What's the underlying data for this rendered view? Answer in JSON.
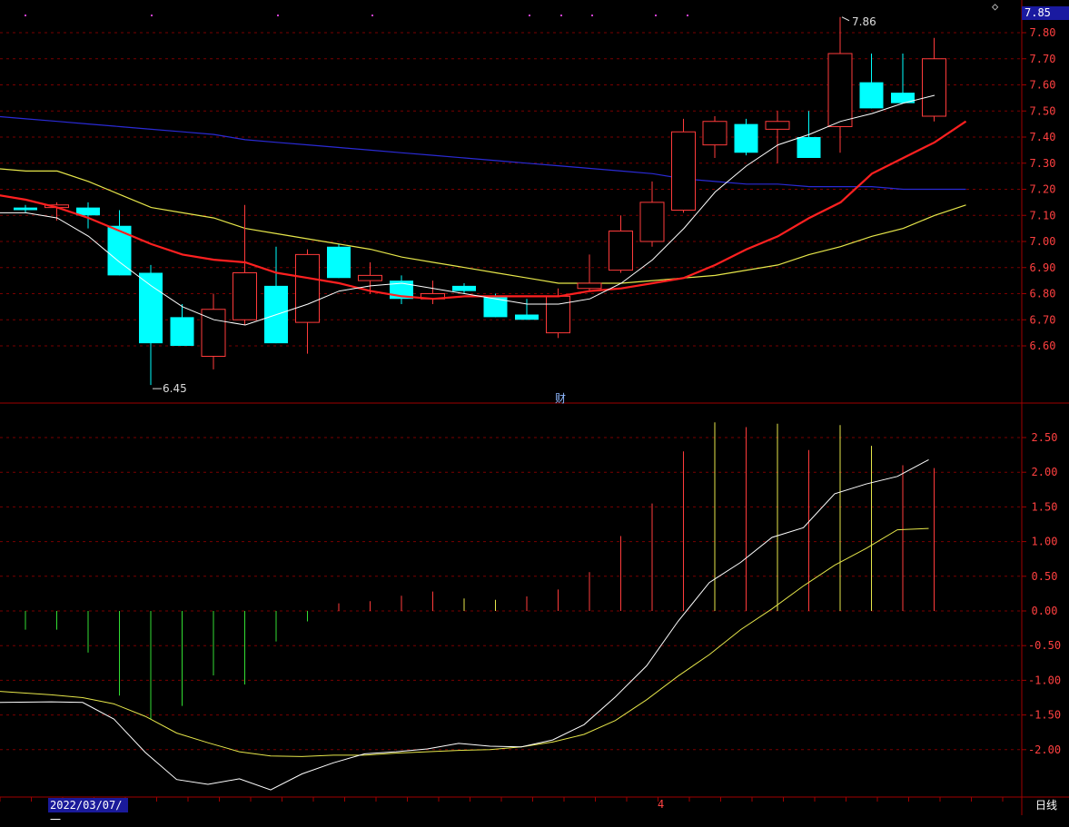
{
  "chart_data": [
    {
      "type": "candlestick",
      "name_id": "price-panel",
      "y_ticks": [
        "7.80",
        "7.70",
        "7.60",
        "7.50",
        "7.40",
        "7.30",
        "7.20",
        "7.10",
        "7.00",
        "6.90",
        "6.80",
        "6.70",
        "6.60"
      ],
      "ylim": [
        6.38,
        7.88
      ],
      "current_price": "7.85",
      "high_annotation": "7.86",
      "low_annotation": "6.45",
      "candles": [
        {
          "o": 7.13,
          "h": 7.14,
          "l": 7.11,
          "c": 7.12
        },
        {
          "o": 7.13,
          "h": 7.15,
          "l": 7.08,
          "c": 7.14
        },
        {
          "o": 7.13,
          "h": 7.15,
          "l": 7.05,
          "c": 7.1
        },
        {
          "o": 7.06,
          "h": 7.12,
          "l": 6.87,
          "c": 6.87
        },
        {
          "o": 6.88,
          "h": 6.91,
          "l": 6.45,
          "c": 6.61
        },
        {
          "o": 6.71,
          "h": 6.76,
          "l": 6.6,
          "c": 6.6
        },
        {
          "o": 6.56,
          "h": 6.8,
          "l": 6.51,
          "c": 6.74
        },
        {
          "o": 6.7,
          "h": 7.14,
          "l": 6.68,
          "c": 6.88
        },
        {
          "o": 6.83,
          "h": 6.98,
          "l": 6.61,
          "c": 6.61
        },
        {
          "o": 6.69,
          "h": 6.97,
          "l": 6.57,
          "c": 6.95
        },
        {
          "o": 6.98,
          "h": 6.99,
          "l": 6.86,
          "c": 6.86
        },
        {
          "o": 6.85,
          "h": 6.92,
          "l": 6.8,
          "c": 6.87
        },
        {
          "o": 6.85,
          "h": 6.87,
          "l": 6.76,
          "c": 6.78
        },
        {
          "o": 6.78,
          "h": 6.85,
          "l": 6.76,
          "c": 6.8
        },
        {
          "o": 6.83,
          "h": 6.84,
          "l": 6.8,
          "c": 6.81
        },
        {
          "o": 6.79,
          "h": 6.8,
          "l": 6.71,
          "c": 6.71
        },
        {
          "o": 6.72,
          "h": 6.78,
          "l": 6.7,
          "c": 6.7
        },
        {
          "o": 6.65,
          "h": 6.82,
          "l": 6.63,
          "c": 6.79
        },
        {
          "o": 6.82,
          "h": 6.95,
          "l": 6.81,
          "c": 6.84
        },
        {
          "o": 6.89,
          "h": 7.1,
          "l": 6.88,
          "c": 7.04
        },
        {
          "o": 7.0,
          "h": 7.23,
          "l": 6.98,
          "c": 7.15
        },
        {
          "o": 7.12,
          "h": 7.47,
          "l": 7.11,
          "c": 7.42
        },
        {
          "o": 7.37,
          "h": 7.48,
          "l": 7.32,
          "c": 7.46
        },
        {
          "o": 7.45,
          "h": 7.47,
          "l": 7.33,
          "c": 7.34
        },
        {
          "o": 7.43,
          "h": 7.5,
          "l": 7.3,
          "c": 7.46
        },
        {
          "o": 7.4,
          "h": 7.5,
          "l": 7.32,
          "c": 7.32
        },
        {
          "o": 7.44,
          "h": 7.86,
          "l": 7.34,
          "c": 7.72
        },
        {
          "o": 7.61,
          "h": 7.72,
          "l": 7.51,
          "c": 7.51
        },
        {
          "o": 7.57,
          "h": 7.72,
          "l": 7.53,
          "c": 7.53
        },
        {
          "o": 7.48,
          "h": 7.78,
          "l": 7.46,
          "c": 7.7
        }
      ],
      "ma_white": [
        7.11,
        7.11,
        7.09,
        7.02,
        6.92,
        6.83,
        6.75,
        6.7,
        6.68,
        6.72,
        6.76,
        6.81,
        6.83,
        6.84,
        6.82,
        6.8,
        6.78,
        6.76,
        6.76,
        6.78,
        6.84,
        6.93,
        7.05,
        7.19,
        7.29,
        7.37,
        7.41,
        7.46,
        7.49,
        7.53,
        7.56
      ],
      "ma_red": [
        7.18,
        7.16,
        7.13,
        7.09,
        7.04,
        6.99,
        6.95,
        6.93,
        6.92,
        6.88,
        6.86,
        6.84,
        6.81,
        6.79,
        6.78,
        6.79,
        6.79,
        6.79,
        6.79,
        6.81,
        6.82,
        6.84,
        6.86,
        6.91,
        6.97,
        7.02,
        7.09,
        7.15,
        7.26,
        7.32,
        7.38,
        7.46
      ],
      "ma_yellow": [
        7.28,
        7.27,
        7.27,
        7.23,
        7.18,
        7.13,
        7.11,
        7.09,
        7.05,
        7.03,
        7.01,
        6.99,
        6.97,
        6.94,
        6.92,
        6.9,
        6.88,
        6.86,
        6.84,
        6.84,
        6.84,
        6.85,
        6.86,
        6.87,
        6.89,
        6.91,
        6.95,
        6.98,
        7.02,
        7.05,
        7.1,
        7.14
      ],
      "ma_blue": [
        7.48,
        7.47,
        7.46,
        7.45,
        7.44,
        7.43,
        7.42,
        7.41,
        7.39,
        7.38,
        7.37,
        7.36,
        7.35,
        7.34,
        7.33,
        7.32,
        7.31,
        7.3,
        7.29,
        7.28,
        7.27,
        7.26,
        7.24,
        7.23,
        7.22,
        7.22,
        7.21,
        7.21,
        7.21,
        7.2,
        7.2,
        7.2
      ]
    },
    {
      "type": "macd",
      "name_id": "indicator-panel",
      "y_ticks": [
        "2.50",
        "2.00",
        "1.50",
        "1.00",
        "0.50",
        "0.00",
        "-0.50",
        "-1.00",
        "-1.50",
        "-2.00"
      ],
      "ylim": [
        -2.72,
        2.95
      ],
      "histogram": [
        -0.27,
        -0.27,
        -0.6,
        -1.22,
        -1.56,
        -1.37,
        -0.93,
        -1.06,
        -0.44,
        -0.15,
        0.11,
        0.14,
        0.22,
        0.28,
        0.18,
        0.16,
        0.21,
        0.31,
        0.56,
        1.08,
        1.55,
        2.3,
        2.72,
        2.65,
        2.7,
        2.32,
        2.68,
        2.38,
        2.1,
        2.06
      ],
      "dif": [
        -1.32,
        -1.31,
        -1.32,
        -1.56,
        -2.04,
        -2.43,
        -2.5,
        -2.42,
        -2.58,
        -2.35,
        -2.19,
        -2.06,
        -2.03,
        -1.99,
        -1.91,
        -1.95,
        -1.96,
        -1.86,
        -1.64,
        -1.24,
        -0.79,
        -0.15,
        0.41,
        0.7,
        1.06,
        1.2,
        1.69,
        1.83,
        1.94,
        2.18
      ],
      "dea": [
        -1.16,
        -1.21,
        -1.25,
        -1.34,
        -1.52,
        -1.76,
        -1.9,
        -2.03,
        -2.09,
        -2.1,
        -2.08,
        -2.08,
        -2.05,
        -2.03,
        -2.01,
        -2.0,
        -1.96,
        -1.89,
        -1.78,
        -1.58,
        -1.28,
        -0.94,
        -0.63,
        -0.27,
        0.03,
        0.36,
        0.66,
        0.9,
        1.17,
        1.19
      ]
    }
  ],
  "labels": {
    "date": "2022/03/07/一",
    "period": "日线",
    "marker_cai": "财",
    "marker_month": "4",
    "diamond": "◇"
  },
  "colors": {
    "up": "#ff3b3b",
    "down": "#00ffff",
    "ma_white": "#ffffff",
    "ma_red": "#ff2020",
    "ma_yellow": "#e6e64a",
    "ma_blue": "#2a2ad4",
    "axis": "#a00000",
    "grid": "#7a0000",
    "tick_text": "#ff4040"
  }
}
